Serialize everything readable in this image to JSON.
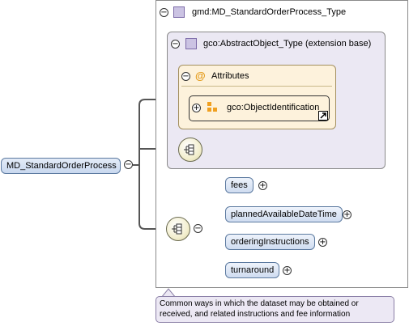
{
  "root": {
    "label": "MD_StandardOrderProcess"
  },
  "type_box": {
    "title": "gmd:MD_StandardOrderProcess_Type"
  },
  "extension_box": {
    "title": "gco:AbstractObject_Type (extension base)"
  },
  "attributes": {
    "title": "Attributes",
    "item": "gco:ObjectIdentification"
  },
  "elements": [
    {
      "label": "fees"
    },
    {
      "label": "plannedAvailableDateTime"
    },
    {
      "label": "orderingInstructions"
    },
    {
      "label": "turnaround"
    }
  ],
  "documentation": {
    "text": "Common ways in which the dataset may be obtained or received, and related instructions and fee information"
  },
  "colors": {
    "element_fill": "#d6e2f3",
    "attribute_fill": "#fdf2dc",
    "type_fill": "#ebe8f3",
    "annotation_fill": "#ece8f4"
  }
}
